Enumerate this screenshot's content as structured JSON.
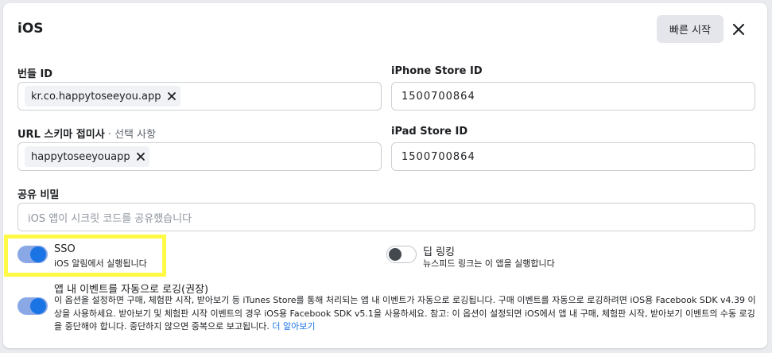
{
  "header": {
    "title": "iOS",
    "quick_start_label": "빠른 시작",
    "close_icon": "close-icon"
  },
  "bundle_id": {
    "label": "번들 ID",
    "chip_text": "kr.co.happytoseeyou.app"
  },
  "iphone_store_id": {
    "label": "iPhone Store ID",
    "value": "1500700864"
  },
  "url_scheme": {
    "label": "URL 스키마 접미사",
    "optional": " · 선택 사항",
    "chip_text": "happytoseeyouapp"
  },
  "ipad_store_id": {
    "label": "iPad Store ID",
    "value": "1500700864"
  },
  "shared_secret": {
    "label": "공유 비밀",
    "placeholder": "iOS 앱이 시크릿 코드를 공유했습니다"
  },
  "sso": {
    "title": "SSO",
    "subtitle": "iOS 알림에서 실행됩니다",
    "enabled": true
  },
  "deep_linking": {
    "title": "딥 링킹",
    "subtitle": "뉴스피드 링크는 이 앱을 실행합니다",
    "enabled": false
  },
  "auto_log_events": {
    "title": "앱 내 이벤트를 자동으로 로깅(권장)",
    "description": "이 옵션을 설정하면 구매, 체험판 시작, 받아보기 등 iTunes Store를 통해 처리되는 앱 내 이벤트가 자동으로 로깅됩니다. 구매 이벤트를 자동으로 로깅하려면 iOS용 Facebook SDK v4.39 이상을 사용하세요. 받아보기 및 체험판 시작 이벤트의 경우 iOS용 Facebook SDK v5.1을 사용하세요. 참고: 이 옵션이 설정되면 iOS에서 앱 내 구매, 체험판 시작, 받아보기 이벤트의 수동 로깅을 중단해야 합니다. 중단하지 않으면 중복으로 보고됩니다.",
    "learn_more": "더 알아보기",
    "enabled": true
  },
  "colors": {
    "accent": "#1b74e4",
    "highlight": "#fffa45"
  }
}
